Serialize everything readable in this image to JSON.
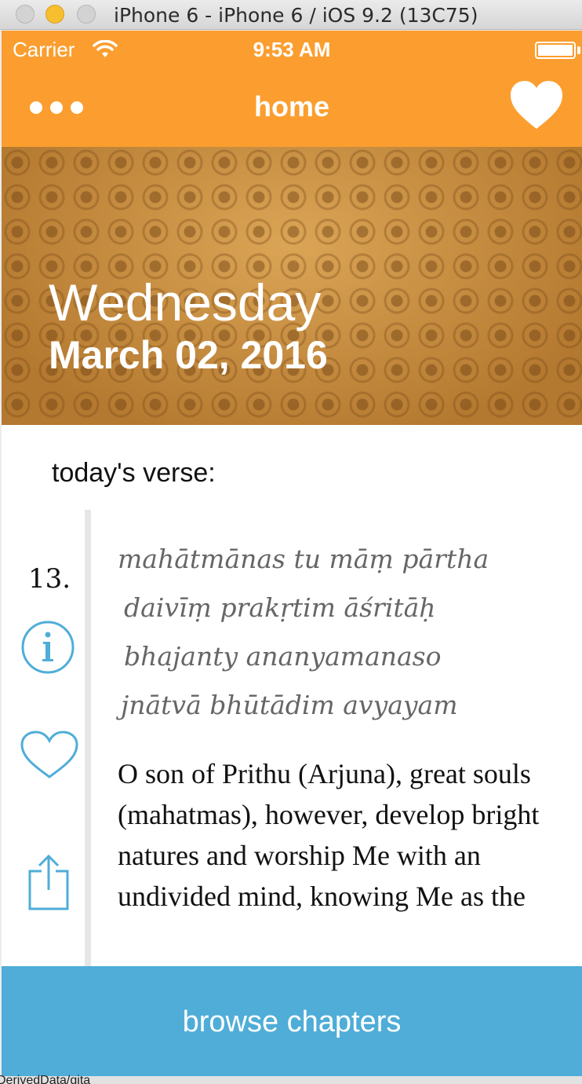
{
  "window": {
    "title": "iPhone 6 - iPhone 6 / iOS 9.2 (13C75)"
  },
  "statusbar": {
    "carrier": "Carrier",
    "time": "9:53 AM",
    "battery_level": 1.0
  },
  "navbar": {
    "title": "home"
  },
  "header": {
    "weekday": "Wednesday",
    "date": "March 02, 2016"
  },
  "verse": {
    "heading": "today's verse:",
    "number": "13.",
    "sanskrit": [
      "mahātmānas tu māṃ pārtha",
      "daivīṃ prakṛtim āśritāḥ",
      "bhajanty ananyamanaso",
      "jnātvā bhūtādim avyayam"
    ],
    "translation": "O son of Prithu (Arjuna), great souls (mahatmas), however, develop bright natures and worship Me with an undivided mind, knowing Me as the"
  },
  "browse": {
    "label": "browse chapters"
  },
  "footer": {
    "path_fragment": "DerivedData/gita"
  },
  "colors": {
    "accent": "#fb9e2f",
    "browse": "#4fadd8",
    "icon": "#4fadd8"
  },
  "icons": [
    "more-icon",
    "heart-icon",
    "wifi-icon",
    "info-icon",
    "share-icon"
  ]
}
